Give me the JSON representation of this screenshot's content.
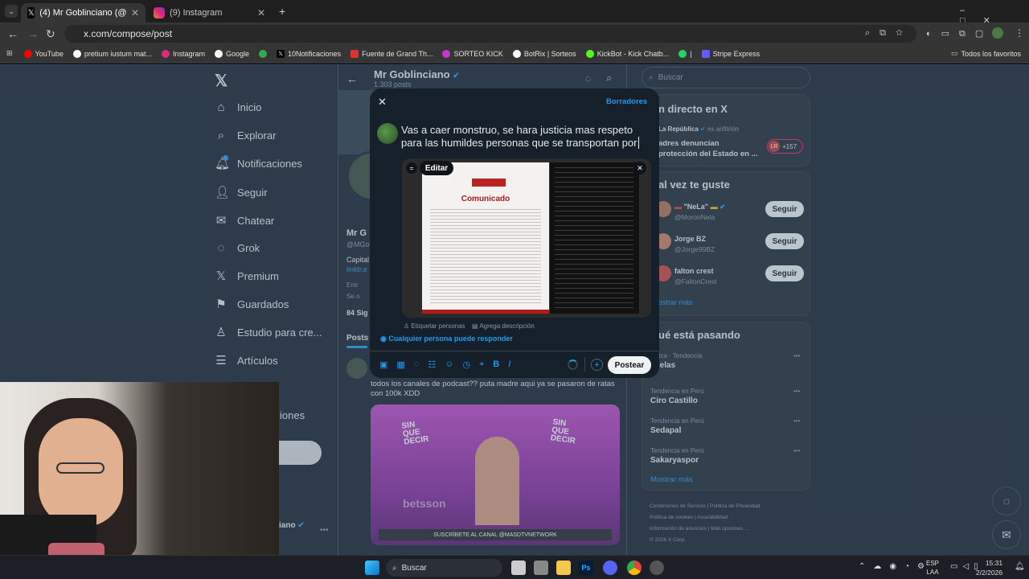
{
  "browser": {
    "tabs": [
      {
        "title": "(4) Mr Goblinciano (@MGoblinc...",
        "active": true
      },
      {
        "title": "(9) Instagram",
        "active": false
      }
    ],
    "url": "x.com/compose/post",
    "bookmarks": [
      "YouTube",
      "pretium iustum mat...",
      "Instagram",
      "Google",
      "10Notificaciones",
      "Fuente de Grand Th...",
      "SORTEO KICK",
      "BotRix | Sorteos",
      "KickBot - Kick Chatb...",
      "|",
      "Stripe Express"
    ],
    "all_bookmarks": "Todos los favoritos"
  },
  "nav": {
    "items": [
      "Inicio",
      "Explorar",
      "Notificaciones",
      "Seguir",
      "Chatear",
      "Grok",
      "Premium",
      "Guardados",
      "Estudio para cre...",
      "Artículos"
    ],
    "more_partial": "iones"
  },
  "profile": {
    "name": "Mr Goblinciano",
    "posts_count": "1.303 posts",
    "name_partial": "Mr G",
    "handle_partial": "@MGo",
    "bio_partial": "Capital",
    "link_partial": "linktr.e",
    "line1_partial": "Entr",
    "line2_partial": "Se o",
    "following_partial": "84 Sig",
    "tab_posts": "Posts",
    "bottom_name": "iano"
  },
  "feed_post": {
    "text": "todos los canales de podcast?? puta madre aqui ya se pasaron de ratas con 100k XDD",
    "video": {
      "banner": "SUSCRÍBETE AL CANAL @MASDTVNETWORK",
      "logo": "SIN QUE DECIR",
      "brand": "betsson"
    }
  },
  "compose": {
    "drafts": "Borradores",
    "text": "Vas a caer monstruo, se hara justicia mas respeto para las humildes personas que se transportan por",
    "edit_label": "Editar",
    "comunicado_title": "Comunicado",
    "tag_people": "Etiquetar personas",
    "add_description": "Agrega descripción",
    "reply_setting": "Cualquier persona puede responder",
    "post_button": "Postear"
  },
  "right": {
    "search_placeholder": "Buscar",
    "live_title": "n directo en X",
    "live_host": "La República",
    "live_host_suffix": "es anfitrión",
    "live_text": "adres denuncian\nprotección del Estado en ...",
    "live_count": "+157",
    "live_avatar": "LR",
    "suggest_title": "al vez te guste",
    "suggestions": [
      {
        "name": "\"NeLa\"",
        "handle": "@MoronNela",
        "button": "Seguir"
      },
      {
        "name": "Jorge BZ",
        "handle": "@Jorge99BZ",
        "button": "Seguir"
      },
      {
        "name": "falton crest",
        "handle": "@FaltonCrest",
        "button": "Seguir"
      }
    ],
    "show_more_1": "ostrar más",
    "trending_title": "ué está pasando",
    "trends": [
      {
        "category": "olítica · Tendencia",
        "name": "uselas"
      },
      {
        "category": "Tendencia en Perú",
        "name": "Ciro Castillo"
      },
      {
        "category": "Tendencia en Perú",
        "name": "Sedapal"
      },
      {
        "category": "Tendencia en Perú",
        "name": "Sakaryaspor"
      }
    ],
    "show_more_2": "Mostrar más",
    "footer": [
      "Condiciones de Servicio",
      "Política de Privacidad",
      "Política de cookies",
      "Accesibilidad",
      "Información de anuncios",
      "Más opciones ...",
      "© 2026 X Corp."
    ]
  },
  "taskbar": {
    "search": "Buscar",
    "lang": "ESP",
    "lang2": "LAA",
    "time": "15:31",
    "date": "2/2/2026"
  }
}
